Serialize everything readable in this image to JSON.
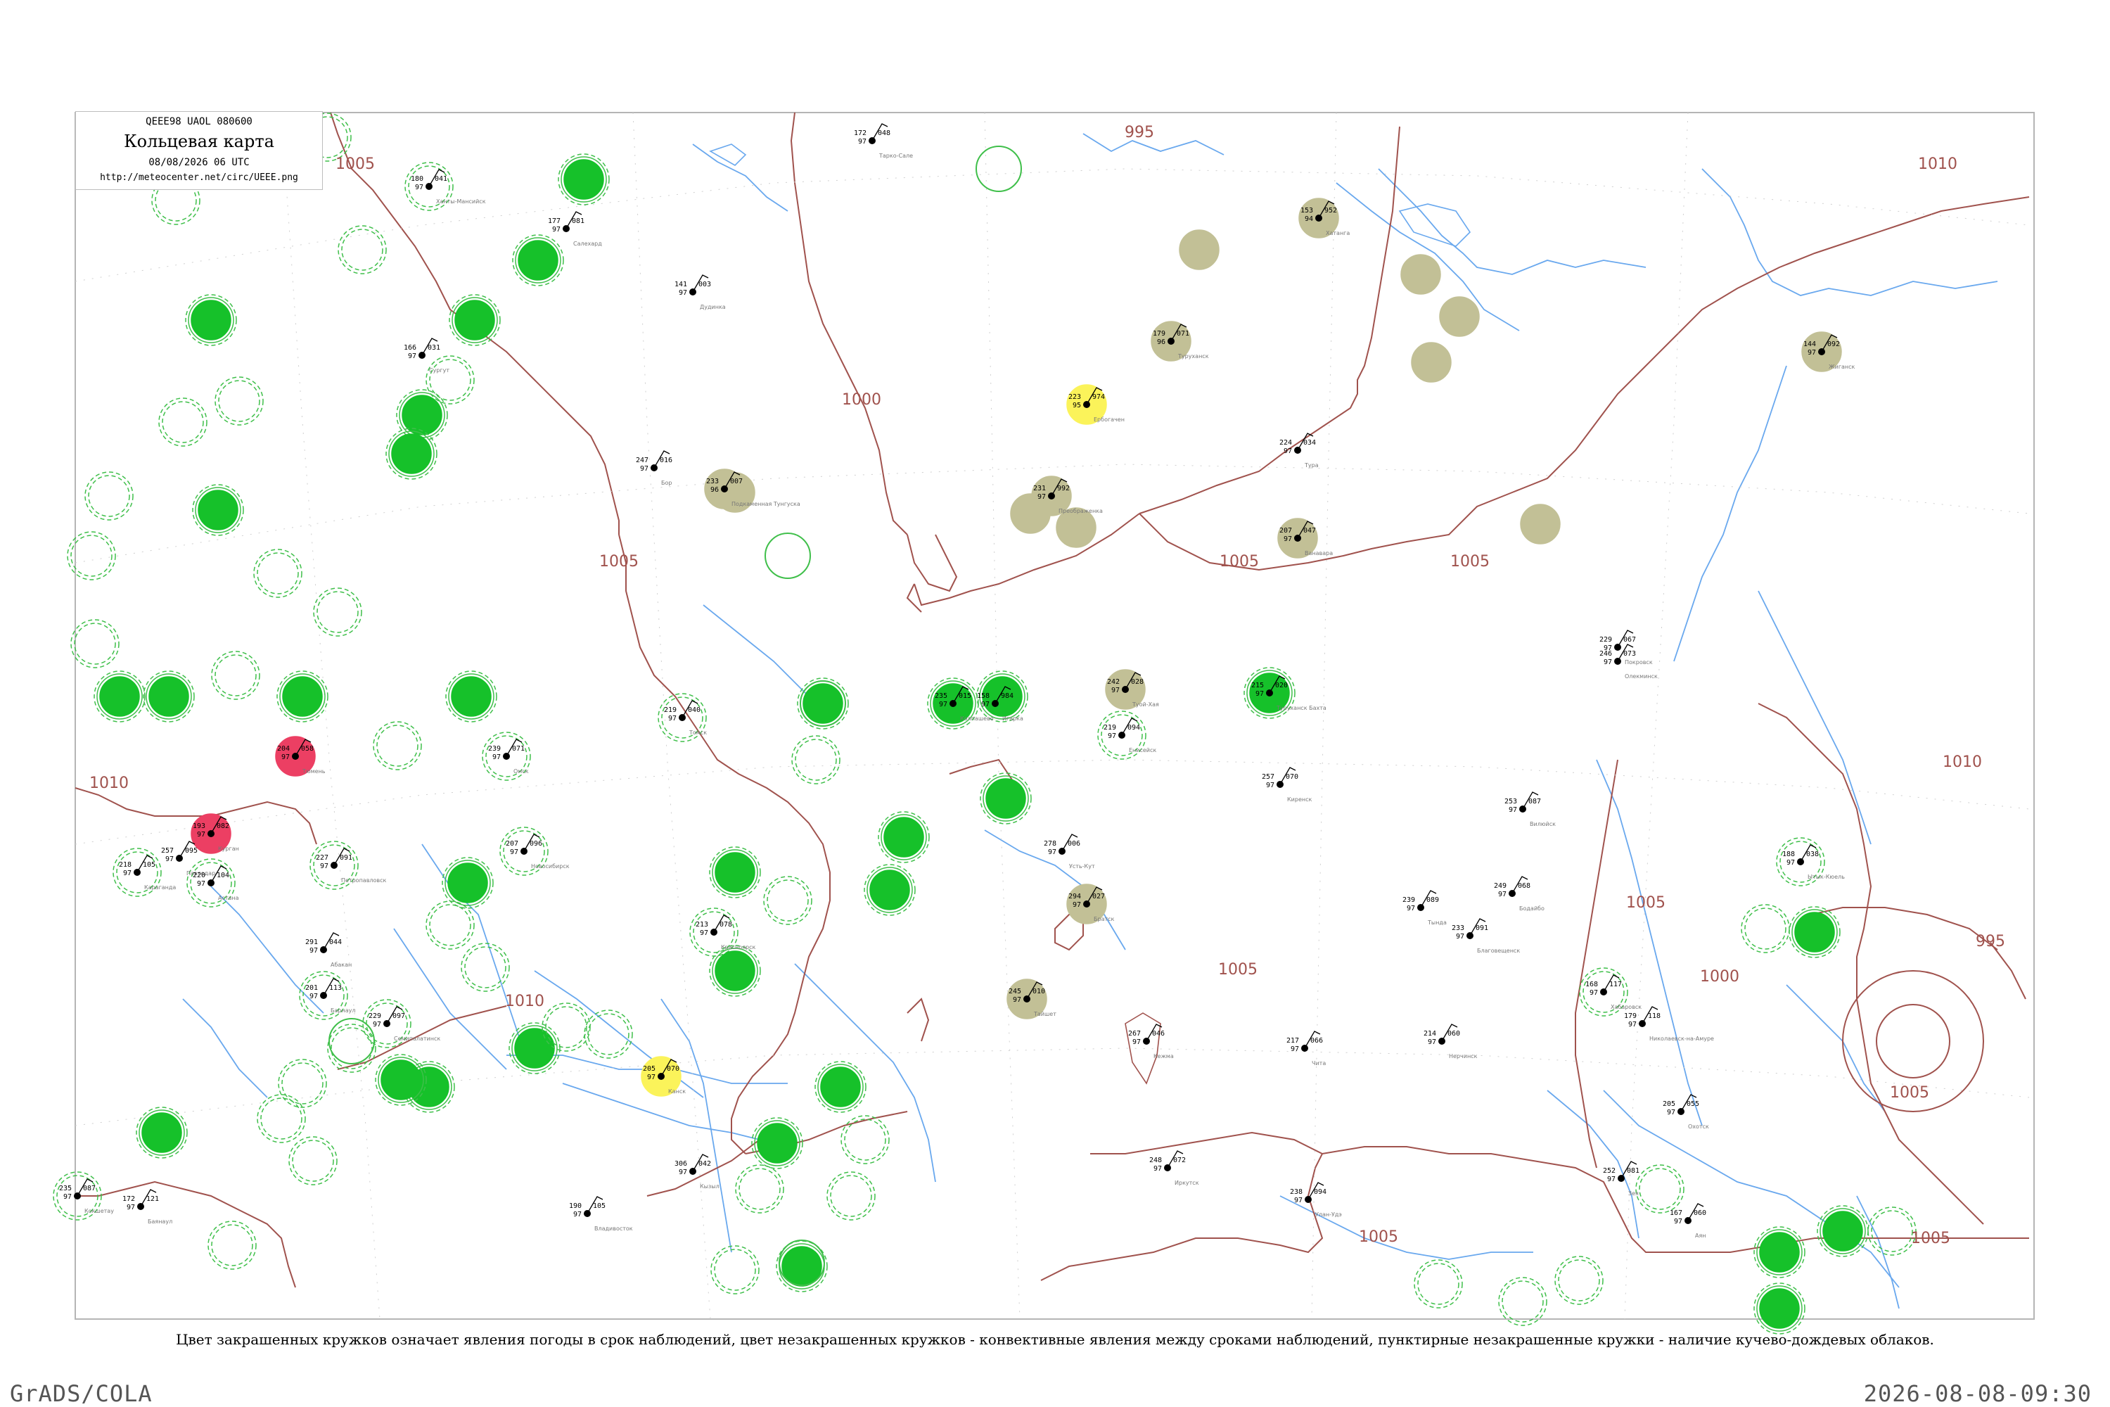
{
  "header": {
    "code_line": "QEEE98  UAOL  080600",
    "title": "Кольцевая карта",
    "datetime": "08/08/2026 06 UTC",
    "url": "http://meteocenter.net/circ/UEEE.png"
  },
  "caption": "Цвет закрашенных кружков означает явления погоды в срок наблюдений, цвет незакрашенных кружков - конвективные явления между сроками наблюдений, пунктирные незакрашенные кружки - наличие кучево-дождевых облаков.",
  "footer": {
    "left": "GrADS/COLA",
    "right": "2026-08-08-09:30"
  },
  "isobar_labels": [
    "995",
    "1005",
    "1000",
    "1005",
    "1010",
    "1005",
    "1005",
    "1010",
    "1005",
    "1000",
    "995",
    "1005",
    "1010",
    "1005",
    "1005",
    "1005",
    "1010"
  ],
  "colors": {
    "green_fill": "#16c12a",
    "green_ring": "#3fbf4a",
    "olive_fill": "#c2c096",
    "yellow_fill": "#fbf35a",
    "red_fill": "#ec3f63",
    "isobar": "#a0524d",
    "river": "#69a8ee",
    "frame": "#b5b5b5"
  },
  "legend_kinds": [
    "filled-green",
    "filled-olive",
    "filled-yellow",
    "filled-red",
    "open-green",
    "dashed-green"
  ],
  "stations": [
    {
      "name": "Покровск",
      "temp": "229",
      "dew": "97",
      "press": "067",
      "kind": "none"
    },
    {
      "name": "Олекминск",
      "temp": "246",
      "dew": "97",
      "press": "073",
      "kind": "none"
    },
    {
      "name": "Ытык-Кюель",
      "temp": "188",
      "dew": "97",
      "press": "038",
      "kind": "dashed-green"
    },
    {
      "name": "Вилюйск",
      "temp": "253",
      "dew": "97",
      "press": "087",
      "kind": "none"
    },
    {
      "name": "Туой-Хая",
      "temp": "242",
      "dew": "97",
      "press": "028",
      "kind": "filled-olive"
    },
    {
      "name": "Ербогачен",
      "temp": "223",
      "dew": "95",
      "press": "974",
      "kind": "filled-yellow"
    },
    {
      "name": "Преображенка",
      "temp": "231",
      "dew": "97",
      "press": "992",
      "kind": "filled-olive"
    },
    {
      "name": "Туруханск",
      "temp": "179",
      "dew": "96",
      "press": "071",
      "kind": "filled-olive"
    },
    {
      "name": "Хатанга",
      "temp": "153",
      "dew": "94",
      "press": "952",
      "kind": "filled-olive"
    },
    {
      "name": "Жиганск",
      "temp": "144",
      "dew": "97",
      "press": "092",
      "kind": "filled-olive"
    },
    {
      "name": "Ванавара",
      "temp": "207",
      "dew": "97",
      "press": "047",
      "kind": "filled-olive"
    },
    {
      "name": "Киренск",
      "temp": "257",
      "dew": "97",
      "press": "070",
      "kind": "none"
    },
    {
      "name": "Бодайбо",
      "temp": "249",
      "dew": "97",
      "press": "068",
      "kind": "none"
    },
    {
      "name": "Усть-Кут",
      "temp": "278",
      "dew": "97",
      "press": "006",
      "kind": "none"
    },
    {
      "name": "Братск",
      "temp": "294",
      "dew": "97",
      "press": "027",
      "kind": "filled-olive"
    },
    {
      "name": "Тайшет",
      "temp": "245",
      "dew": "97",
      "press": "010",
      "kind": "filled-olive"
    },
    {
      "name": "Канск",
      "temp": "205",
      "dew": "97",
      "press": "070",
      "kind": "filled-yellow"
    },
    {
      "name": "Красноярск",
      "temp": "213",
      "dew": "97",
      "press": "078",
      "kind": "dashed-green"
    },
    {
      "name": "Енисейск",
      "temp": "219",
      "dew": "97",
      "press": "094",
      "kind": "dashed-green"
    },
    {
      "name": "Тура",
      "temp": "224",
      "dew": "97",
      "press": "034",
      "kind": "none"
    },
    {
      "name": "Бор",
      "temp": "247",
      "dew": "97",
      "press": "016",
      "kind": "none"
    },
    {
      "name": "Подкаменная Тунгуска",
      "temp": "233",
      "dew": "96",
      "press": "007",
      "kind": "filled-olive"
    },
    {
      "name": "Колпашево",
      "temp": "235",
      "dew": "97",
      "press": "015",
      "kind": "filled-green"
    },
    {
      "name": "Томск",
      "temp": "219",
      "dew": "97",
      "press": "040",
      "kind": "dashed-green"
    },
    {
      "name": "Новосибирск",
      "temp": "207",
      "dew": "97",
      "press": "096",
      "kind": "dashed-green"
    },
    {
      "name": "Барнаул",
      "temp": "201",
      "dew": "97",
      "press": "113",
      "kind": "dashed-green"
    },
    {
      "name": "Омск",
      "temp": "239",
      "dew": "97",
      "press": "071",
      "kind": "dashed-green"
    },
    {
      "name": "Тюмень",
      "temp": "204",
      "dew": "97",
      "press": "058",
      "kind": "filled-red"
    },
    {
      "name": "Курган",
      "temp": "193",
      "dew": "97",
      "press": "082",
      "kind": "filled-red"
    },
    {
      "name": "Сургут",
      "temp": "166",
      "dew": "97",
      "press": "031",
      "kind": "none"
    },
    {
      "name": "Ханты-Мансийск",
      "temp": "180",
      "dew": "97",
      "press": "041",
      "kind": "dashed-green"
    },
    {
      "name": "Салехард",
      "temp": "177",
      "dew": "97",
      "press": "081",
      "kind": "none"
    },
    {
      "name": "Тарко-Сале",
      "temp": "172",
      "dew": "97",
      "press": "048",
      "kind": "none"
    },
    {
      "name": "Дудинка",
      "temp": "141",
      "dew": "97",
      "press": "003",
      "kind": "none"
    },
    {
      "name": "Игарка",
      "temp": "158",
      "dew": "97",
      "press": "984",
      "kind": "none"
    },
    {
      "name": "Туруханск Бахта",
      "temp": "215",
      "dew": "97",
      "press": "020",
      "kind": "filled-green"
    },
    {
      "name": "Кежма",
      "temp": "267",
      "dew": "97",
      "press": "046",
      "kind": "none"
    },
    {
      "name": "Иркутск",
      "temp": "248",
      "dew": "97",
      "press": "072",
      "kind": "none"
    },
    {
      "name": "Улан-Удэ",
      "temp": "238",
      "dew": "97",
      "press": "094",
      "kind": "none"
    },
    {
      "name": "Чита",
      "temp": "217",
      "dew": "97",
      "press": "066",
      "kind": "none"
    },
    {
      "name": "Нерчинск",
      "temp": "214",
      "dew": "97",
      "press": "060",
      "kind": "none"
    },
    {
      "name": "Благовещенск",
      "temp": "233",
      "dew": "97",
      "press": "091",
      "kind": "none"
    },
    {
      "name": "Тында",
      "temp": "239",
      "dew": "97",
      "press": "089",
      "kind": "none"
    },
    {
      "name": "Зея",
      "temp": "252",
      "dew": "97",
      "press": "081",
      "kind": "none"
    },
    {
      "name": "Хабаровск",
      "temp": "168",
      "dew": "97",
      "press": "117",
      "kind": "dashed-green"
    },
    {
      "name": "Николаевск-на-Амуре",
      "temp": "179",
      "dew": "97",
      "press": "118",
      "kind": "none"
    },
    {
      "name": "Охотск",
      "temp": "205",
      "dew": "97",
      "press": "055",
      "kind": "none"
    },
    {
      "name": "Аян",
      "temp": "167",
      "dew": "97",
      "press": "060",
      "kind": "none"
    },
    {
      "name": "Владивосток",
      "temp": "190",
      "dew": "97",
      "press": "105",
      "kind": "none"
    },
    {
      "name": "Кызыл",
      "temp": "306",
      "dew": "97",
      "press": "042",
      "kind": "none"
    },
    {
      "name": "Абакан",
      "temp": "291",
      "dew": "97",
      "press": "044",
      "kind": "none"
    },
    {
      "name": "Семипалатинск",
      "temp": "229",
      "dew": "97",
      "press": "097",
      "kind": "dashed-green"
    },
    {
      "name": "Павлодар",
      "temp": "257",
      "dew": "97",
      "press": "095",
      "kind": "none"
    },
    {
      "name": "Караганда",
      "temp": "218",
      "dew": "97",
      "press": "105",
      "kind": "dashed-green"
    },
    {
      "name": "Астана",
      "temp": "220",
      "dew": "97",
      "press": "104",
      "kind": "dashed-green"
    },
    {
      "name": "Петропавловск",
      "temp": "227",
      "dew": "97",
      "press": "091",
      "kind": "dashed-green"
    },
    {
      "name": "Кокшетау",
      "temp": "235",
      "dew": "97",
      "press": "087",
      "kind": "dashed-green"
    },
    {
      "name": "Баянаул",
      "temp": "172",
      "dew": "97",
      "press": "121",
      "kind": "none"
    },
    {
      "name": "Уральск",
      "temp": "237",
      "dew": "97",
      "press": "072",
      "kind": "none"
    }
  ]
}
